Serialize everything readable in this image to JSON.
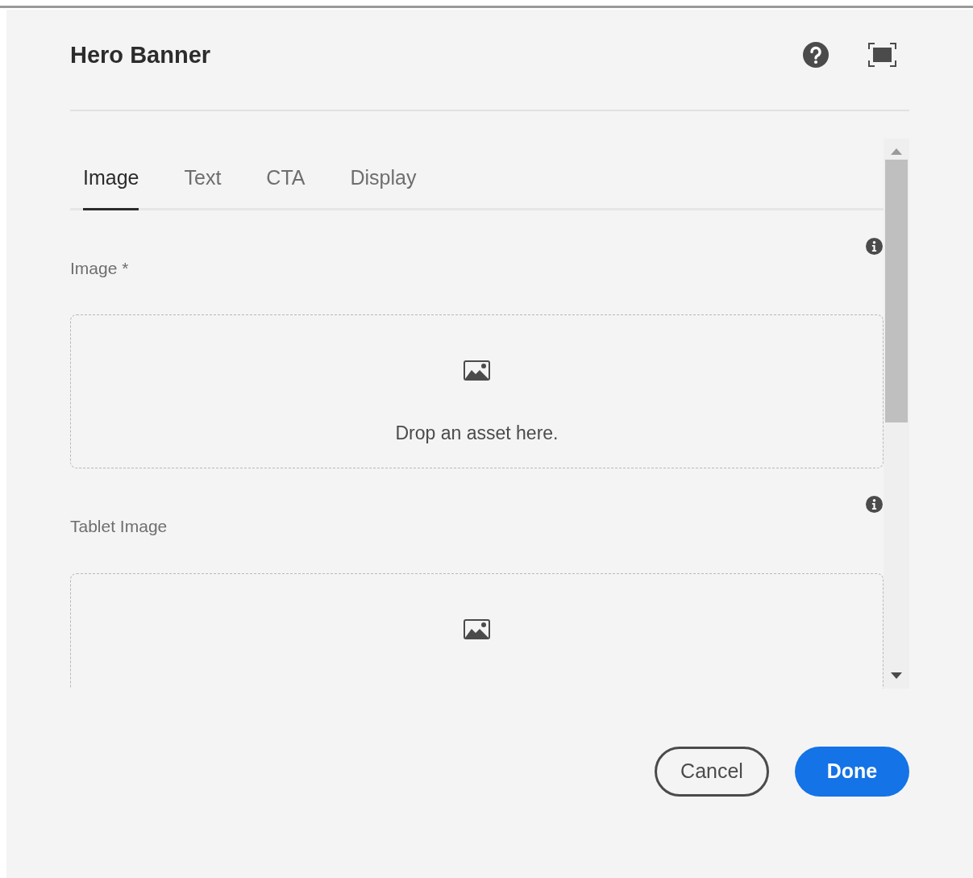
{
  "dialog": {
    "title": "Hero Banner"
  },
  "tabs": [
    {
      "label": "Image",
      "selected": true
    },
    {
      "label": "Text",
      "selected": false
    },
    {
      "label": "CTA",
      "selected": false
    },
    {
      "label": "Display",
      "selected": false
    }
  ],
  "fields": [
    {
      "label": "Image *",
      "drop_text": "Drop an asset here."
    },
    {
      "label": "Tablet Image"
    }
  ],
  "buttons": [
    {
      "label": "Cancel",
      "kind": "secondary"
    },
    {
      "label": "Done",
      "kind": "primary"
    }
  ]
}
